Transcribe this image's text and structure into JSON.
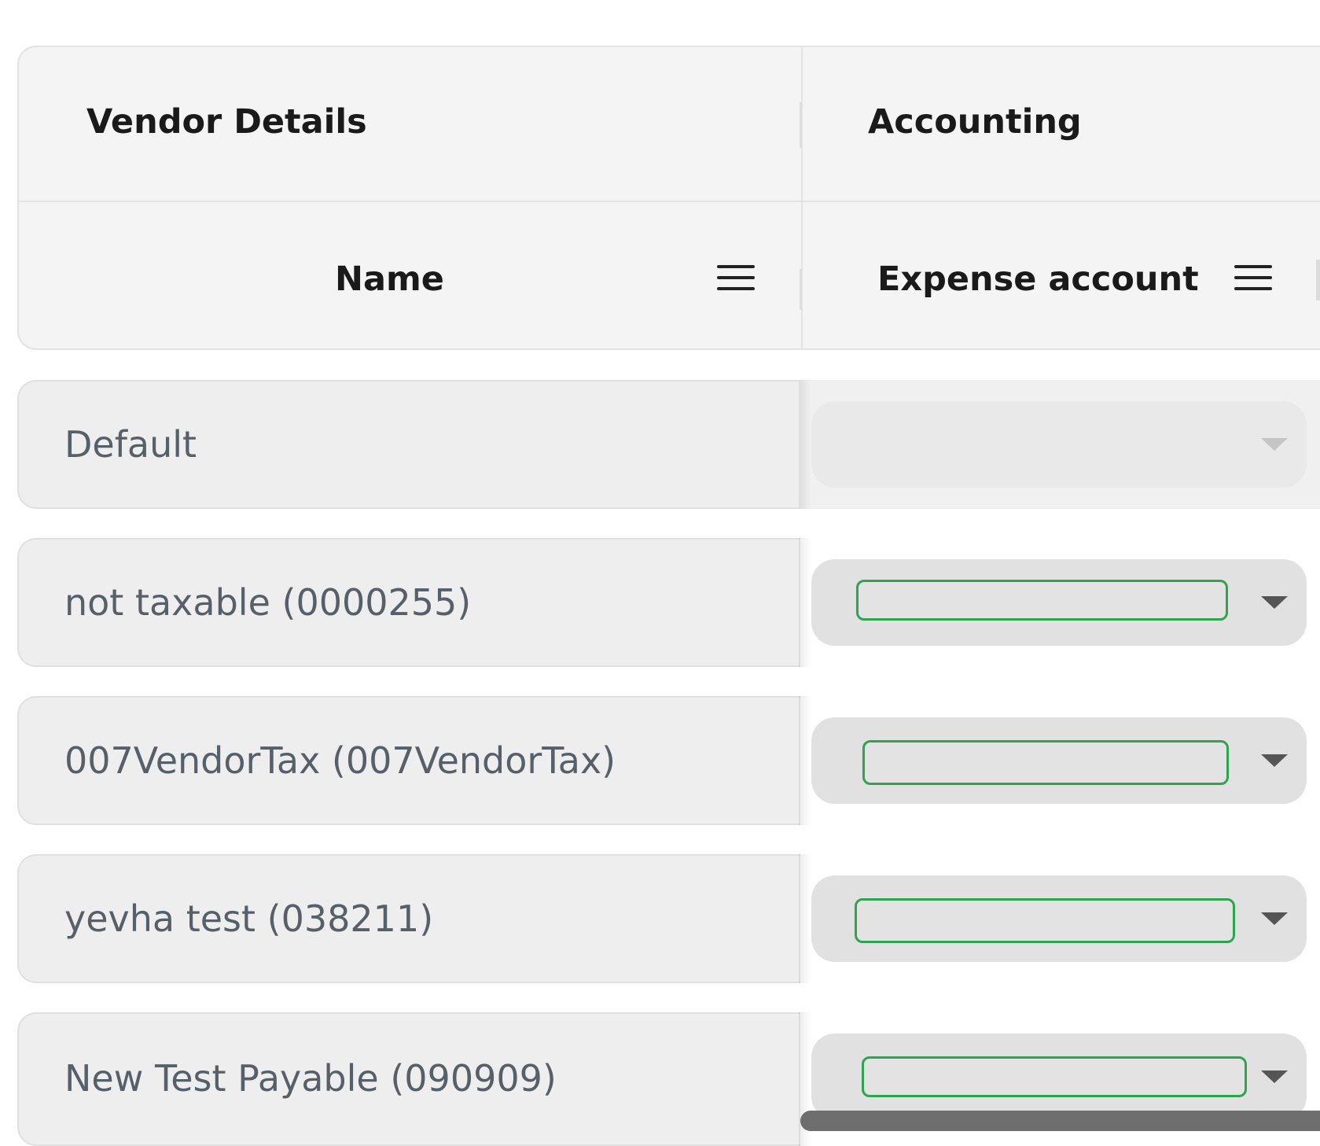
{
  "header": {
    "groups": [
      {
        "label": "Vendor Details"
      },
      {
        "label": "Accounting"
      }
    ],
    "columns": [
      {
        "label": "Name",
        "menu_icon": "hamburger-menu-icon"
      },
      {
        "label": "Expense account",
        "menu_icon": "hamburger-menu-icon"
      }
    ]
  },
  "rows": [
    {
      "name": "Default",
      "expense_account": "",
      "disabled": true
    },
    {
      "name": "not taxable (0000255)",
      "expense_account": "",
      "disabled": false
    },
    {
      "name": "007VendorTax (007VendorTax)",
      "expense_account": "",
      "disabled": false
    },
    {
      "name": "yevha test (038211)",
      "expense_account": "",
      "disabled": false
    },
    {
      "name": "New Test Payable (090909)",
      "expense_account": "",
      "disabled": false
    }
  ],
  "colors": {
    "header_bg": "#f4f4f4",
    "row_bg": "#eeeeee",
    "row_text": "#56606a",
    "select_bg": "#e1e1e1",
    "focus_border": "#2ea44f"
  }
}
